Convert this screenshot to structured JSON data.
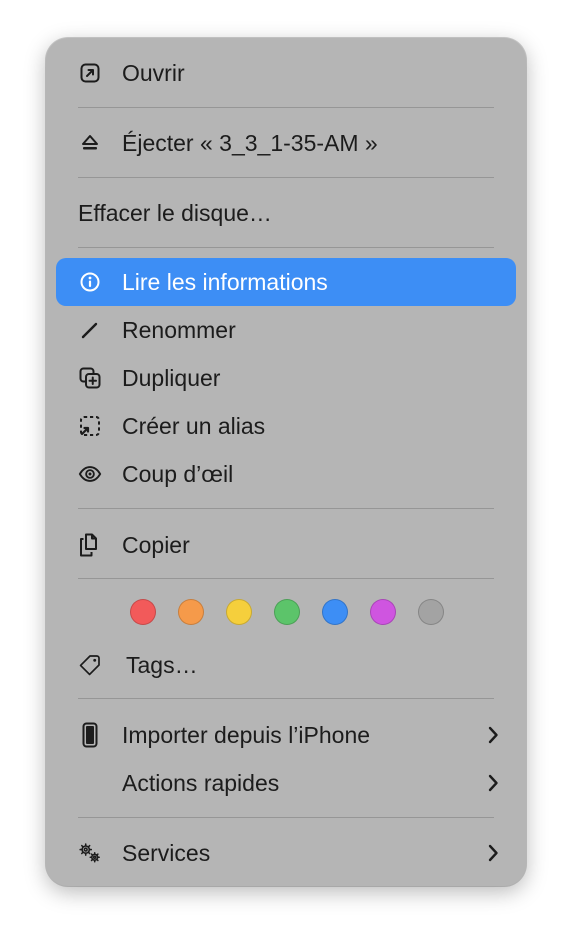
{
  "menu": {
    "open": {
      "label": "Ouvrir",
      "icon": "open-icon"
    },
    "eject": {
      "label": "Éjecter « 3_3_1-35-AM »",
      "icon": "eject-icon"
    },
    "erase": {
      "label": "Effacer le disque…"
    },
    "get_info": {
      "label": "Lire les informations",
      "icon": "info-icon",
      "highlighted": true
    },
    "rename": {
      "label": "Renommer",
      "icon": "pencil-icon"
    },
    "duplicate": {
      "label": "Dupliquer",
      "icon": "duplicate-icon"
    },
    "make_alias": {
      "label": "Créer un alias",
      "icon": "alias-icon"
    },
    "quick_look": {
      "label": "Coup d’œil",
      "icon": "eye-icon"
    },
    "copy": {
      "label": "Copier",
      "icon": "copy-icon"
    },
    "tag_colors": [
      {
        "name": "red",
        "color": "#f25a5a"
      },
      {
        "name": "orange",
        "color": "#f59a4a"
      },
      {
        "name": "yellow",
        "color": "#f5cf3c"
      },
      {
        "name": "green",
        "color": "#5cc46a"
      },
      {
        "name": "blue",
        "color": "#3d8ef5"
      },
      {
        "name": "purple",
        "color": "#cf55e0"
      },
      {
        "name": "gray",
        "color": "#a3a3a3"
      }
    ],
    "tags": {
      "label": "Tags…",
      "icon": "tag-icon"
    },
    "import_iphone": {
      "label": "Importer depuis l’iPhone",
      "icon": "iphone-icon"
    },
    "quick_actions": {
      "label": "Actions rapides"
    },
    "services": {
      "label": "Services",
      "icon": "gears-icon"
    }
  },
  "colors": {
    "menu_background": "#b5b5b5",
    "highlight": "#3d8ef5",
    "text": "#1c1c1c"
  }
}
